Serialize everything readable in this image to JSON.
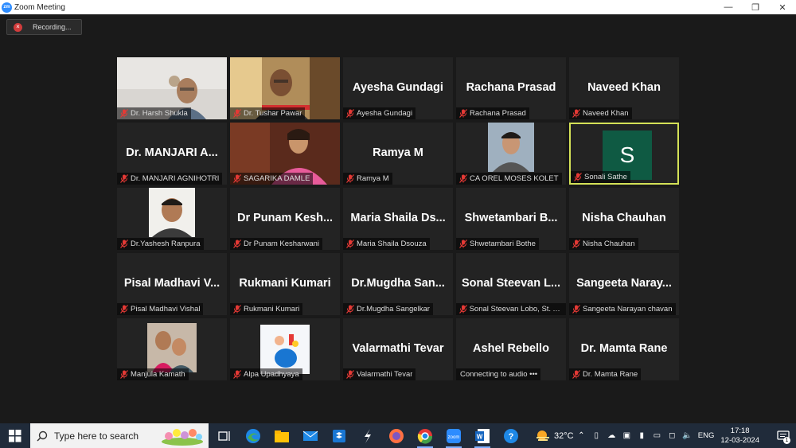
{
  "window": {
    "title": "Zoom Meeting",
    "logo": "zm"
  },
  "recording": {
    "label": "Recording..."
  },
  "tiles": [
    {
      "name": "",
      "label": "Dr. Harsh Shukla",
      "video": "man-glasses"
    },
    {
      "name": "",
      "label": "Dr. Tushar Pawar",
      "video": "man-room"
    },
    {
      "name": "Ayesha Gundagi",
      "label": "Ayesha Gundagi"
    },
    {
      "name": "Rachana Prasad",
      "label": "Rachana Prasad"
    },
    {
      "name": "Naveed Khan",
      "label": "Naveed Khan"
    },
    {
      "name": "Dr. MANJARI A...",
      "label": "Dr. MANJARI AGNIHOTRI"
    },
    {
      "name": "",
      "label": "SAGARIKA DAMLE",
      "video": "woman-pink"
    },
    {
      "name": "Ramya M",
      "label": "Ramya M"
    },
    {
      "name": "",
      "label": "CA OREL MOSES KOLET",
      "video": "young-man"
    },
    {
      "name": "",
      "label": "Sonali Sathe",
      "avatar": "S",
      "active": true
    },
    {
      "name": "",
      "label": "Dr.Yashesh Ranpura",
      "video": "man-smile"
    },
    {
      "name": "Dr Punam Kesh...",
      "label": "Dr Punam Kesharwani"
    },
    {
      "name": "Maria Shaila Ds...",
      "label": "Maria Shaila Dsouza"
    },
    {
      "name": "Shwetambari B...",
      "label": "Shwetambari Bothe"
    },
    {
      "name": "Nisha Chauhan",
      "label": "Nisha Chauhan"
    },
    {
      "name": "Pisal Madhavi V...",
      "label": "Pisal Madhavi Vishal"
    },
    {
      "name": "Rukmani Kumari",
      "label": "Rukmani Kumari"
    },
    {
      "name": "Dr.Mugdha San...",
      "label": "Dr.Mugdha Sangelkar"
    },
    {
      "name": "Sonal Steevan L...",
      "label": "Sonal Steevan Lobo, St. Al..."
    },
    {
      "name": "Sangeeta Naray...",
      "label": "Sangeeta Narayan  chavan"
    },
    {
      "name": "",
      "label": "Manjula Kamath",
      "video": "selfie"
    },
    {
      "name": "",
      "label": "Alpa Upadhyaya",
      "video": "illustration"
    },
    {
      "name": "Valarmathi Tevar",
      "label": "Valarmathi Tevar"
    },
    {
      "name": "Ashel Rebello",
      "label": "Connecting to audio •••",
      "connecting": true
    },
    {
      "name": "Dr. Mamta Rane",
      "label": "Dr. Mamta Rane"
    }
  ],
  "taskbar": {
    "search_placeholder": "Type here to search",
    "apps": [
      "task-view-icon",
      "edge-icon",
      "file-explorer-icon",
      "mail-icon",
      "dropbox-icon",
      "s-app-icon",
      "firefox-icon",
      "chrome-icon",
      "zoom-icon",
      "word-icon",
      "help-icon"
    ],
    "weather": "32°C",
    "lang": "ENG",
    "time": "17:18",
    "date": "12-03-2024",
    "notifications": "1"
  },
  "colors": {
    "active_border": "#d4e157",
    "muted_mic": "#e53935",
    "tile_bg": "#232323",
    "accent": "#2d8cff"
  }
}
